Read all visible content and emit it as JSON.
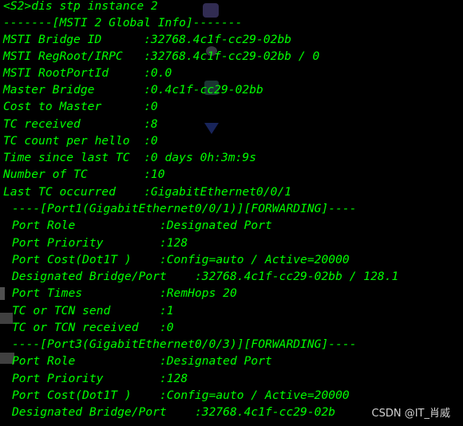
{
  "terminal": {
    "background": "#000000",
    "text_color": "#00ff00",
    "lines": [
      "<S2>dis stp instance 2",
      "-------[MSTI 2 Global Info]-------",
      "MSTI Bridge ID      :32768.4c1f-cc29-02bb",
      "MSTI RegRoot/IRPC   :32768.4c1f-cc29-02bb / 0",
      "MSTI RootPortId     :0.0",
      "Master Bridge       :0.4c1f-cc29-02bb",
      "Cost to Master      :0",
      "TC received         :8",
      "TC count per hello  :0",
      "Time since last TC  :0 days 0h:3m:9s",
      "Number of TC        :10",
      "Last TC occurred    :GigabitEthernet0/0/1",
      "----[Port1(GigabitEthernet0/0/1)][FORWARDING]----",
      "Port Role            :Designated Port",
      "Port Priority        :128",
      "Port Cost(Dot1T )    :Config=auto / Active=20000",
      "Designated Bridge/Port    :32768.4c1f-cc29-02bb / 128.1",
      "Port Times           :RemHops 20",
      "TC or TCN send       :1",
      "TC or TCN received   :0",
      "----[Port3(GigabitEthernet0/0/3)][FORWARDING]----",
      "Port Role            :Designated Port",
      "Port Priority        :128",
      "Port Cost(Dot1T )    :Config=auto / Active=20000",
      "Designated Bridge/Port    :32768.4c1f-cc29-02b"
    ]
  },
  "watermark": {
    "text": "CSDN @IT_肖威"
  }
}
